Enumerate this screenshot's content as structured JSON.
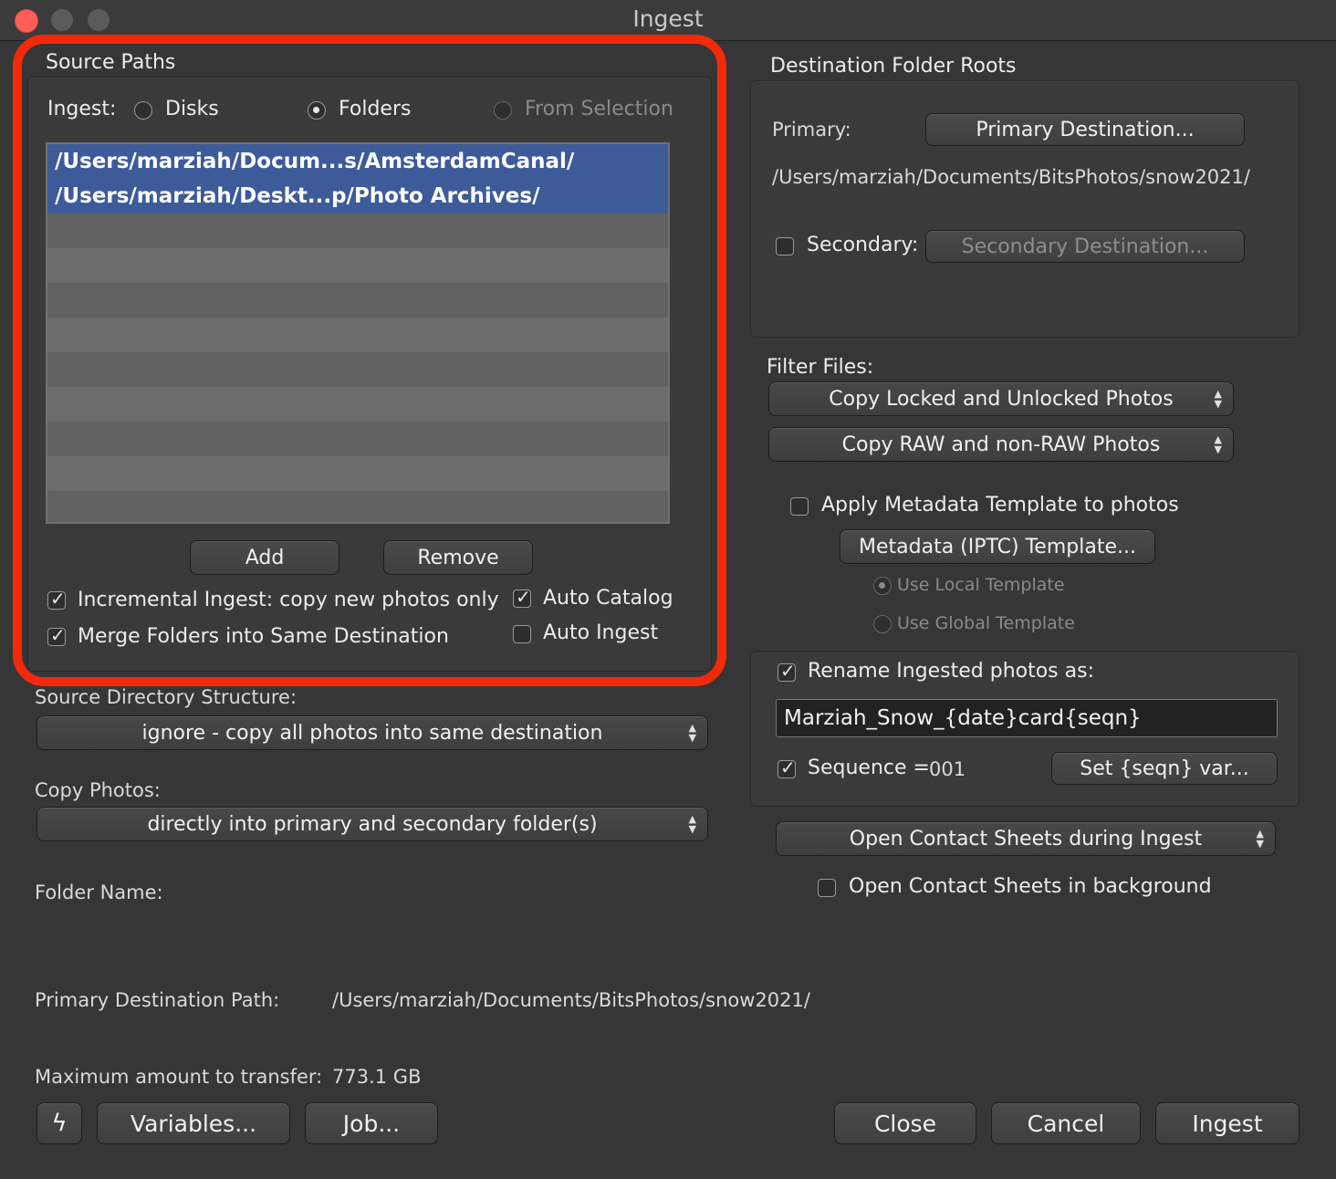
{
  "window": {
    "title": "Ingest"
  },
  "source": {
    "group_title": "Source Paths",
    "ingest_label": "Ingest:",
    "options": [
      "Disks",
      "Folders",
      "From Selection"
    ],
    "selected_option": "Folders",
    "paths": [
      "/Users/marziah/Docum...s/AmsterdamCanal/",
      "/Users/marziah/Deskt...p/Photo Archives/"
    ],
    "add_label": "Add",
    "remove_label": "Remove",
    "incremental_label": "Incremental Ingest: copy new photos only",
    "incremental_checked": true,
    "merge_label": "Merge Folders into Same Destination",
    "merge_checked": true,
    "auto_catalog_label": "Auto Catalog",
    "auto_catalog_checked": true,
    "auto_ingest_label": "Auto Ingest",
    "auto_ingest_checked": false
  },
  "left": {
    "structure_label": "Source Directory Structure:",
    "structure_value": "ignore - copy all photos into same destination",
    "copy_photos_label": "Copy Photos:",
    "copy_photos_value": "directly into primary and secondary folder(s)",
    "folder_name_label": "Folder Name:",
    "primary_path_label": "Primary Destination Path:",
    "primary_path_value": "/Users/marziah/Documents/BitsPhotos/snow2021/",
    "max_transfer_label": "Maximum amount to transfer:",
    "max_transfer_value": "773.1 GB"
  },
  "destination": {
    "group_title": "Destination Folder Roots",
    "primary_label": "Primary:",
    "primary_button": "Primary Destination...",
    "primary_path": "/Users/marziah/Documents/BitsPhotos/snow2021/",
    "secondary_label": "Secondary:",
    "secondary_checked": false,
    "secondary_button": "Secondary Destination..."
  },
  "filter": {
    "label": "Filter Files:",
    "locked_value": "Copy Locked and Unlocked Photos",
    "raw_value": "Copy RAW and non-RAW Photos"
  },
  "metadata": {
    "apply_label": "Apply Metadata Template to photos",
    "apply_checked": false,
    "template_button": "Metadata (IPTC) Template...",
    "local_label": "Use Local Template",
    "global_label": "Use Global Template",
    "selected": "Use Local Template"
  },
  "rename": {
    "label": "Rename Ingested photos as:",
    "checked": true,
    "pattern": "Marziah_Snow_{date}card{seqn}",
    "sequence_label": "Sequence =",
    "sequence_value": "001",
    "sequence_checked": true,
    "seqn_button": "Set {seqn} var..."
  },
  "contact": {
    "popup_value": "Open Contact Sheets during Ingest",
    "background_label": "Open Contact Sheets in background",
    "background_checked": false
  },
  "bottom": {
    "variables_label": "Variables...",
    "job_label": "Job...",
    "close_label": "Close",
    "cancel_label": "Cancel",
    "ingest_label": "Ingest"
  },
  "colors": {
    "highlight": "#f22a0c",
    "selection": "#3d5b99"
  }
}
